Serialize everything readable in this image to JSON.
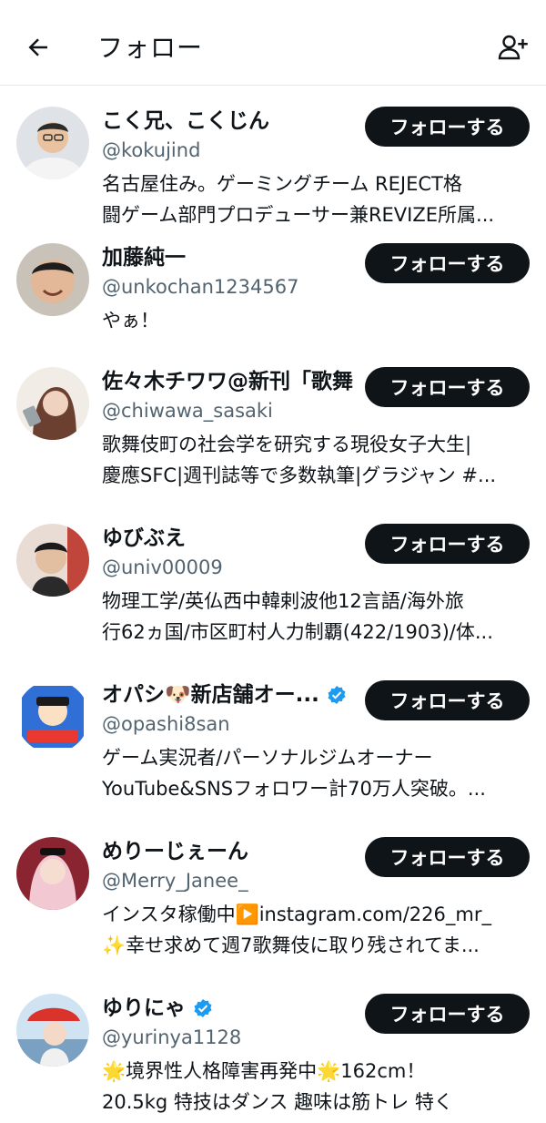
{
  "header": {
    "title": "フォロー",
    "back_icon": "arrow-left-icon",
    "add_icon": "person-add-icon"
  },
  "colors": {
    "text": "#0f1419",
    "muted": "#536471",
    "button": "#0f1419",
    "verified": "#1d9bf0"
  },
  "follow_label": "フォローする",
  "users": [
    {
      "name": "こく兄、こくじん",
      "handle": "@kokujind",
      "verified": false,
      "bio": [
        "名古屋住み。ゲーミングチーム REJECT格",
        "闘ゲーム部門プロデューサー兼REVIZE所属..."
      ]
    },
    {
      "name": "加藤純一",
      "handle": "@unkochan1234567",
      "verified": false,
      "bio": [
        "やぁ！"
      ]
    },
    {
      "name": "佐々木チワワ@新刊「歌舞",
      "handle": "@chiwawa_sasaki",
      "verified": false,
      "bio": [
        "歌舞伎町の社会学を研究する現役女子大生|",
        "慶應SFC|週刊誌等で多数執筆|グラジャン #..."
      ]
    },
    {
      "name": "ゆびぶえ",
      "handle": "@univ00009",
      "verified": false,
      "bio": [
        "物理工学/英仏西中韓剌波他12言語/海外旅",
        "行62ヵ国/市区町村人力制覇(422/1903)/体..."
      ]
    },
    {
      "name": "オパシ🐶新店舗オー...",
      "handle": "@opashi8san",
      "verified": true,
      "bio": [
        "ゲーム実況者/パーソナルジムオーナー",
        "YouTube&SNSフォロワー計70万人突破。..."
      ]
    },
    {
      "name": "めりーじぇーん",
      "handle": "@Merry_Janee_",
      "verified": false,
      "bio": [
        "インスタ稼働中▶️instagram.com/226_mr_",
        "✨幸せ求めて週7歌舞伎に取り残されてま..."
      ]
    },
    {
      "name": "ゆりにゃ",
      "handle": "@yurinya1128",
      "verified": true,
      "bio": [
        "🌟境界性人格障害再発中🌟162cm！",
        "20.5kg 特技はダンス 趣味は筋トレ 特く"
      ]
    }
  ]
}
